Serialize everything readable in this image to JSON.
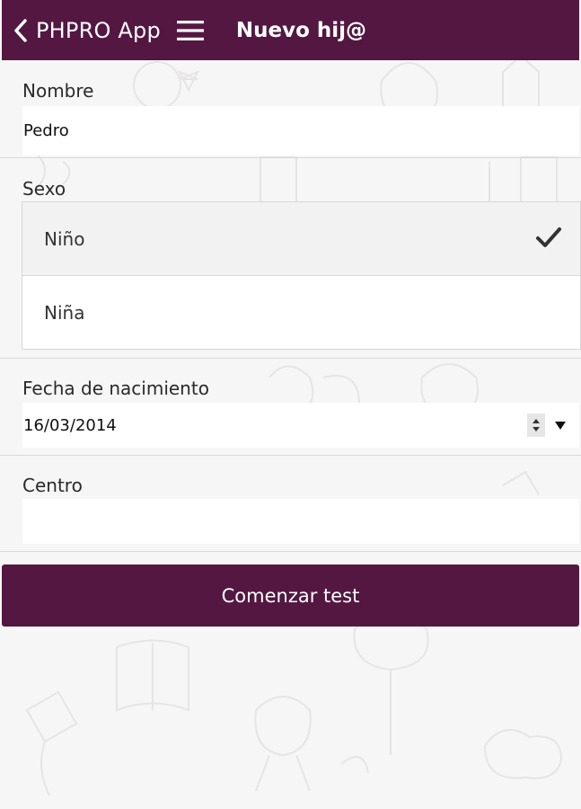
{
  "header": {
    "app_name": "PHPRO App",
    "page_title": "Nuevo hij@",
    "bar_color": "#531742"
  },
  "form": {
    "nombre": {
      "label": "Nombre",
      "value": "Pedro"
    },
    "sexo": {
      "label": "Sexo",
      "options": [
        {
          "label": "Niño",
          "selected": true
        },
        {
          "label": "Niña",
          "selected": false
        }
      ]
    },
    "fecha": {
      "label": "Fecha de nacimiento",
      "value": "16/03/2014"
    },
    "centro": {
      "label": "Centro",
      "value": ""
    }
  },
  "actions": {
    "start_label": "Comenzar test"
  },
  "icons": {
    "back": "chevron-left-icon",
    "menu": "hamburger-menu-icon",
    "check": "checkmark-icon",
    "spin": "spinner-updown-icon",
    "dropdown": "caret-down-icon"
  }
}
